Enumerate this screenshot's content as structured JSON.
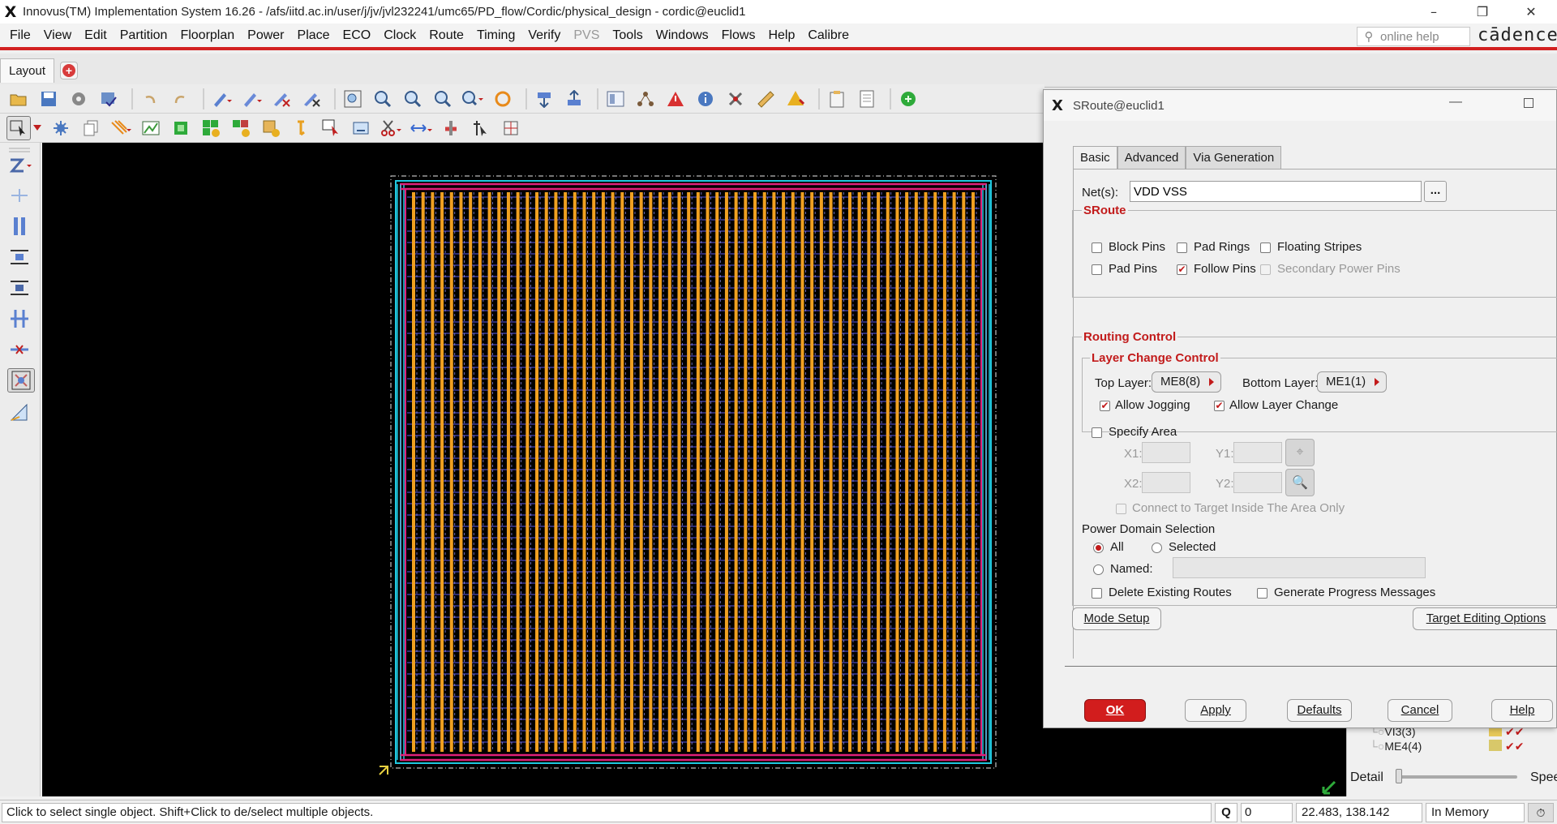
{
  "window": {
    "title": "Innovus(TM) Implementation System 16.26 - /afs/iitd.ac.in/user/j/jv/jvl232241/umc65/PD_flow/Cordic/physical_design - cordic@euclid1",
    "minimize": "–",
    "restore": "❐",
    "close": "✕"
  },
  "menubar": {
    "items": [
      "File",
      "View",
      "Edit",
      "Partition",
      "Floorplan",
      "Power",
      "Place",
      "ECO",
      "Clock",
      "Route",
      "Timing",
      "Verify",
      "PVS",
      "Tools",
      "Windows",
      "Flows",
      "Help",
      "Calibre"
    ],
    "disabled": [
      "PVS"
    ],
    "help_placeholder": "online help",
    "brand": "cādence"
  },
  "tabs": {
    "layout": "Layout"
  },
  "sidepanel": {
    "rows": [
      "VI3(3)",
      "ME4(4)"
    ],
    "detail": "Detail",
    "speed": "Speed",
    "slider_value": 0
  },
  "statusbar": {
    "message": "Click to select single object. Shift+Click to de/select multiple objects.",
    "q": "Q",
    "count": "0",
    "coords": "22.483, 138.142",
    "memory": "In Memory"
  },
  "dialog": {
    "title": "SRoute@euclid1",
    "tabs": [
      "Basic",
      "Advanced",
      "Via Generation"
    ],
    "active_tab": "Basic",
    "nets_label": "Net(s):",
    "nets_value": "VDD VSS",
    "browse": "...",
    "sroute_section": "SRoute",
    "block_pins": "Block Pins",
    "pad_rings": "Pad Rings",
    "floating_stripes": "Floating Stripes",
    "pad_pins": "Pad Pins",
    "follow_pins": "Follow Pins",
    "secondary_power_pins": "Secondary Power Pins",
    "routing_control": "Routing Control",
    "layer_change_control": "Layer Change Control",
    "top_layer_label": "Top Layer:",
    "top_layer_value": "ME8(8)",
    "bottom_layer_label": "Bottom Layer:",
    "bottom_layer_value": "ME1(1)",
    "allow_jogging": "Allow Jogging",
    "allow_layer_change": "Allow Layer Change",
    "specify_area": "Specify Area",
    "x1": "X1:",
    "y1": "Y1:",
    "x2": "X2:",
    "y2": "Y2:",
    "connect_target": "Connect to Target Inside The Area Only",
    "power_domain": "Power Domain Selection",
    "pd_all": "All",
    "pd_selected": "Selected",
    "pd_named": "Named:",
    "delete_existing": "Delete Existing Routes",
    "gen_progress": "Generate Progress Messages",
    "mode_setup": "Mode Setup",
    "target_editing": "Target Editing Options",
    "ok": "OK",
    "apply": "Apply",
    "defaults": "Defaults",
    "cancel": "Cancel",
    "help": "Help",
    "checked": {
      "block_pins": false,
      "pad_rings": false,
      "floating_stripes": false,
      "pad_pins": false,
      "follow_pins": true,
      "secondary_power_pins": false,
      "allow_jogging": true,
      "allow_layer_change": true,
      "specify_area": false,
      "delete_existing": false,
      "gen_progress": false
    },
    "power_domain_choice": "All"
  },
  "colors": {
    "accent_red": "#c21b1b",
    "stripe_orange": "#f0a020",
    "ring_magenta": "#e0207a",
    "ring_cyan": "#20c8e0",
    "rail_blue": "#5a5ae8"
  }
}
